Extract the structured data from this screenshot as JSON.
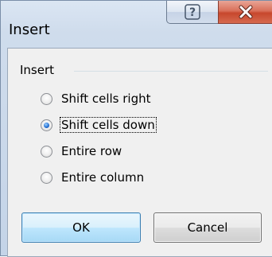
{
  "window": {
    "title": "Insert",
    "help_glyph": "?",
    "close_glyph": "X"
  },
  "group": {
    "label": "Insert"
  },
  "options": [
    {
      "label": "Shift cells right",
      "checked": false
    },
    {
      "label": "Shift cells down",
      "checked": true
    },
    {
      "label": "Entire row",
      "checked": false
    },
    {
      "label": "Entire column",
      "checked": false
    }
  ],
  "buttons": {
    "ok": "OK",
    "cancel": "Cancel"
  },
  "colors": {
    "close_button": "#c7472d",
    "selected_radio": "#2a74d6",
    "default_button_border": "#3c7fb1"
  }
}
